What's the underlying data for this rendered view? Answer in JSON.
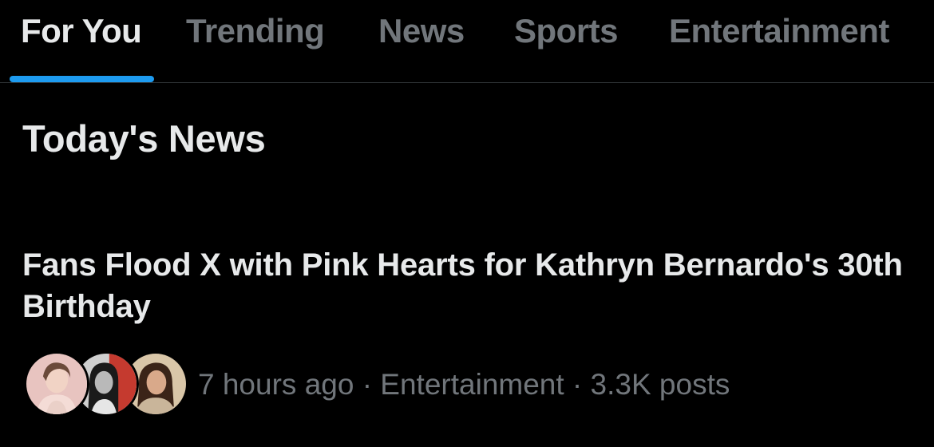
{
  "tabs": [
    {
      "label": "For You",
      "active": true
    },
    {
      "label": "Trending",
      "active": false
    },
    {
      "label": "News",
      "active": false
    },
    {
      "label": "Sports",
      "active": false
    },
    {
      "label": "Entertainment",
      "active": false
    }
  ],
  "colors": {
    "background": "#000000",
    "text_primary": "#e7e9ea",
    "text_secondary": "#71767b",
    "accent": "#1d9bf0",
    "divider": "#2f3336"
  },
  "section": {
    "title": "Today's News"
  },
  "story": {
    "headline": "Fans Flood X with Pink Hearts for Kathryn Bernardo's 30th Birthday",
    "meta": "7 hours ago · Entertainment · 3.3K posts",
    "avatars": [
      "avatar-photo-1",
      "avatar-photo-2",
      "avatar-photo-3"
    ]
  }
}
